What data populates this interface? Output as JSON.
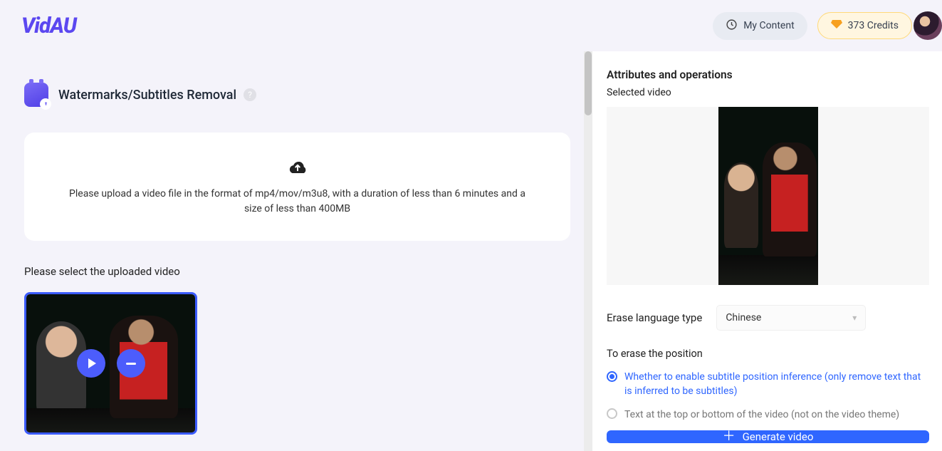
{
  "header": {
    "logo": "VidAU",
    "my_content": "My Content",
    "credits": "373 Credits"
  },
  "page": {
    "title": "Watermarks/Subtitles Removal",
    "help_glyph": "?"
  },
  "upload": {
    "instructions": "Please upload a video file in the format of mp4/mov/m3u8, with a duration of less than 6 minutes and a size of less than 400MB"
  },
  "select_label": "Please select the uploaded video",
  "right": {
    "attrs_title": "Attributes and operations",
    "selected_label": "Selected video",
    "erase_lang_label": "Erase language type",
    "erase_lang_value": "Chinese",
    "pos_title": "To erase the position",
    "options": [
      {
        "label": "Whether to enable subtitle position inference (only remove text that is inferred to be subtitles)",
        "checked": true
      },
      {
        "label": "Text at the top or bottom of the video (not on the video theme)",
        "checked": false
      }
    ],
    "generate": "Generate video"
  }
}
